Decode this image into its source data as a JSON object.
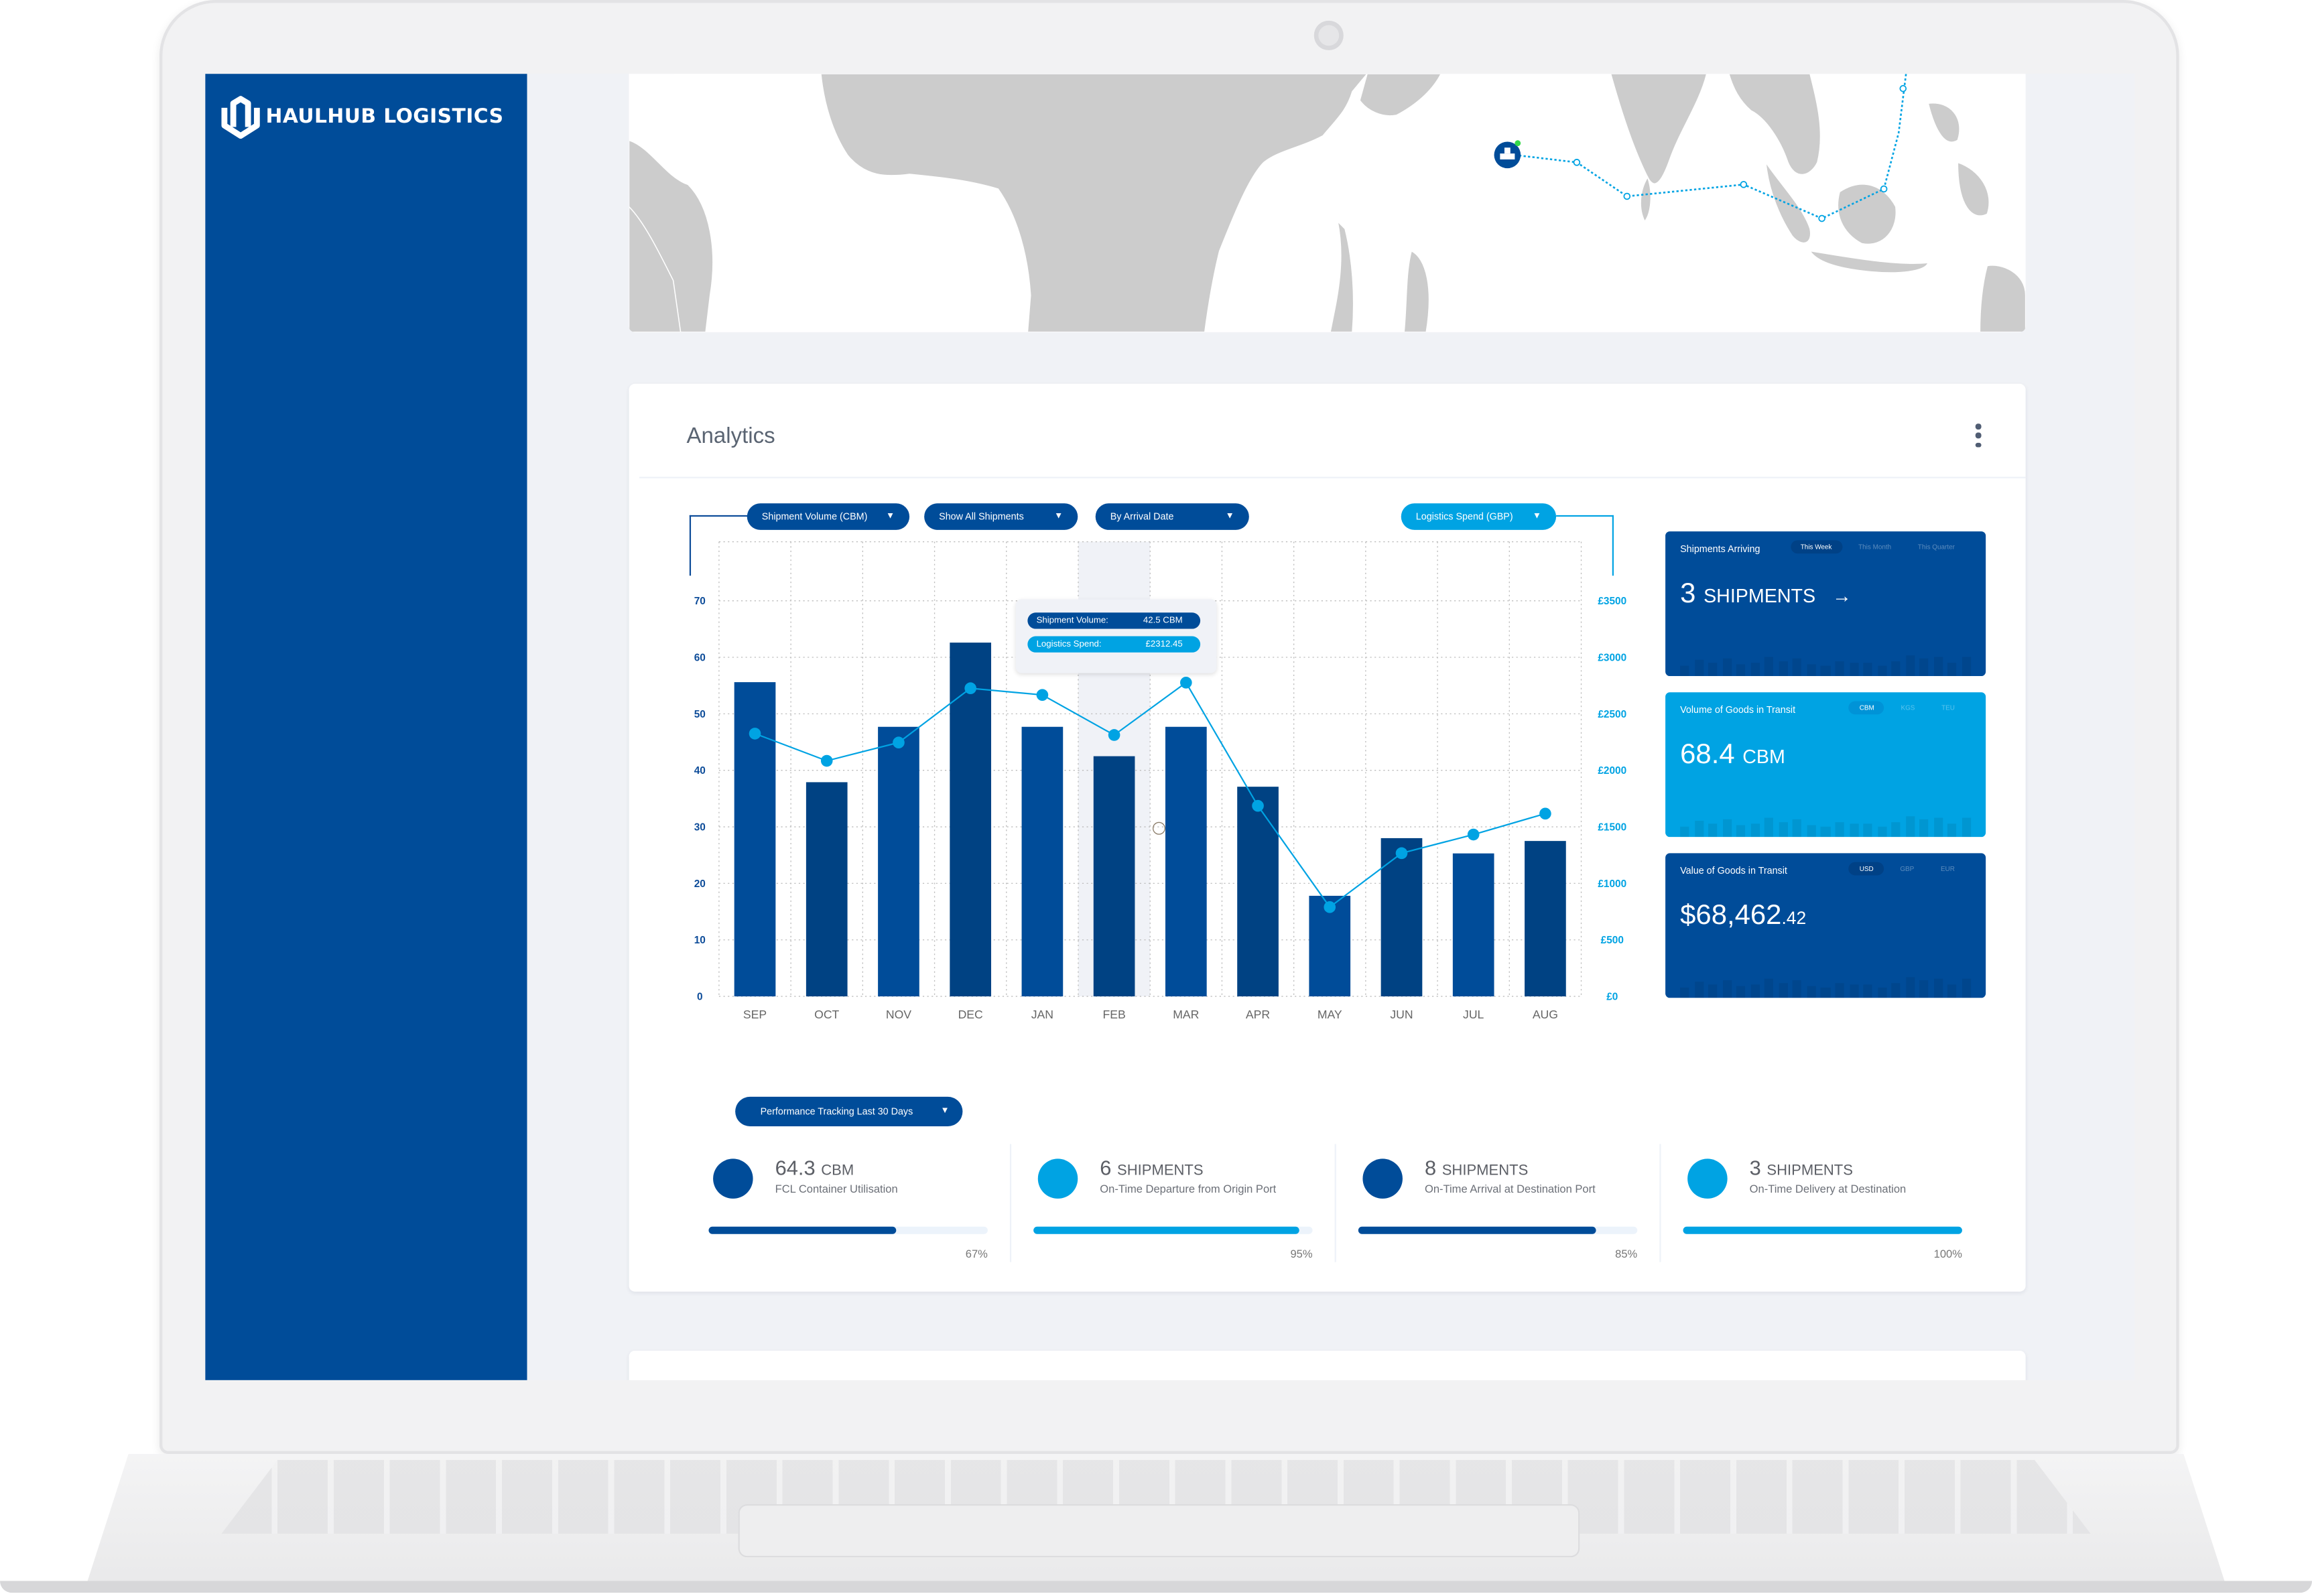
{
  "brand": {
    "name": "HAULHUB LOGISTICS",
    "logo_icon": "hexagon-u-logo-icon"
  },
  "colors": {
    "primary": "#004c99",
    "accent": "#00a3e3",
    "sidebar": "#004c99",
    "background": "#f0f2f6",
    "map_land": "#cccccc"
  },
  "map": {
    "vessel_icon": "ship-icon",
    "route_style": "dotted",
    "route_color": "#00a3e3"
  },
  "analytics": {
    "title": "Analytics",
    "menu_icon": "kebab-menu-icon",
    "filters": [
      {
        "label": "Shipment Volume (CBM)",
        "icon": "caret-down-icon"
      },
      {
        "label": "Show All Shipments",
        "icon": "caret-down-icon"
      },
      {
        "label": "By Arrival Date",
        "icon": "caret-down-icon"
      },
      {
        "label": "Logistics Spend (GBP)",
        "icon": "caret-down-icon"
      }
    ],
    "tooltip": {
      "volume_label": "Shipment Volume:",
      "volume_value": "42.5 CBM",
      "spend_label": "Logistics Spend:",
      "spend_value": "£2312.45"
    },
    "tiles": [
      {
        "title": "Shipments Arriving",
        "tabs": [
          "This Week",
          "This Month",
          "This Quarter"
        ],
        "active_tab": 0,
        "value": "3",
        "unit": "SHIPMENTS",
        "arrow": "→",
        "icon": "arrow-right-icon"
      },
      {
        "title": "Volume of Goods in Transit",
        "tabs": [
          "CBM",
          "KGS",
          "TEU"
        ],
        "active_tab": 0,
        "value": "68.4",
        "unit": "CBM"
      },
      {
        "title": "Value of Goods in Transit",
        "tabs": [
          "USD",
          "GBP",
          "EUR"
        ],
        "active_tab": 0,
        "value": "$68,462",
        "decimals": ".42"
      }
    ],
    "performance": {
      "filter_label": "Performance Tracking Last 30 Days",
      "items": [
        {
          "value": "64.3",
          "unit": "CBM",
          "label": "FCL Container Utilisation",
          "percent": 67,
          "percent_label": "67%",
          "color": "#004c99"
        },
        {
          "value": "6",
          "unit": "SHIPMENTS",
          "label": "On-Time Departure from Origin Port",
          "percent": 95,
          "percent_label": "95%",
          "color": "#00a3e3"
        },
        {
          "value": "8",
          "unit": "SHIPMENTS",
          "label": "On-Time Arrival at Destination Port",
          "percent": 85,
          "percent_label": "85%",
          "color": "#004c99"
        },
        {
          "value": "3",
          "unit": "SHIPMENTS",
          "label": "On-Time Delivery at Destination",
          "percent": 100,
          "percent_label": "100%",
          "color": "#00a3e3"
        }
      ]
    }
  },
  "chart_data": {
    "type": "bar",
    "title": "",
    "categories": [
      "SEP",
      "OCT",
      "NOV",
      "DEC",
      "JAN",
      "FEB",
      "MAR",
      "APR",
      "MAY",
      "JUN",
      "JUL",
      "AUG"
    ],
    "series": [
      {
        "name": "Shipment Volume (CBM)",
        "type": "bar",
        "axis": "left",
        "color": "#004c99",
        "values": [
          55.6,
          37.9,
          47.7,
          62.6,
          47.7,
          42.5,
          47.7,
          37.1,
          17.8,
          28.0,
          25.3,
          27.5
        ]
      },
      {
        "name": "Logistics Spend (GBP)",
        "type": "line",
        "axis": "right",
        "color": "#00a3e3",
        "values": [
          2325,
          2084,
          2246,
          2726,
          2667,
          2312.45,
          2776,
          1686,
          790,
          1267,
          1432,
          1617
        ]
      }
    ],
    "highlighted_category": "FEB",
    "y_left": {
      "ticks": [
        "0",
        "10",
        "20",
        "30",
        "40",
        "50",
        "60",
        "70"
      ],
      "range": [
        0,
        70
      ]
    },
    "y_right": {
      "ticks": [
        "£0",
        "£500",
        "£1000",
        "£1500",
        "£2000",
        "£2500",
        "£3000",
        "£3500"
      ],
      "range": [
        0,
        3500
      ]
    },
    "xlabel": "",
    "ylabel": "",
    "grid": true,
    "legend": "none"
  }
}
